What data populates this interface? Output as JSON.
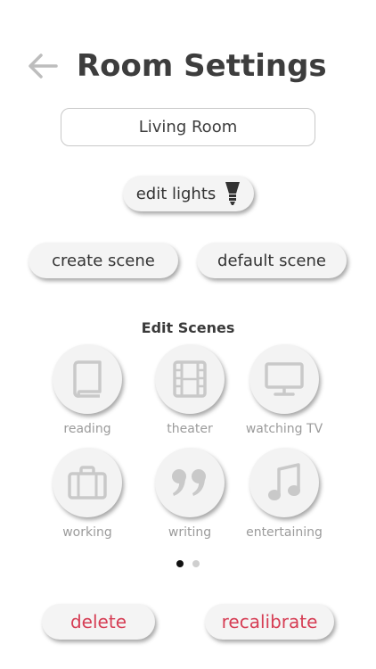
{
  "header": {
    "title": "Room Settings",
    "back_icon": "arrow-left-icon"
  },
  "room": {
    "name": "Living Room"
  },
  "actions": {
    "edit_lights_label": "edit lights",
    "edit_lights_icon": "lightbulb-icon",
    "create_scene_label": "create scene",
    "default_scene_label": "default scene"
  },
  "scenes": {
    "title": "Edit Scenes",
    "items": [
      {
        "label": "reading",
        "icon": "book-icon"
      },
      {
        "label": "theater",
        "icon": "film-icon"
      },
      {
        "label": "watching TV",
        "icon": "monitor-icon"
      },
      {
        "label": "working",
        "icon": "briefcase-icon"
      },
      {
        "label": "writing",
        "icon": "quote-icon"
      },
      {
        "label": "entertaining",
        "icon": "music-note-icon"
      }
    ]
  },
  "pagination": {
    "current": 1,
    "total": 2
  },
  "footer": {
    "delete_label": "delete",
    "recalibrate_label": "recalibrate"
  },
  "colors": {
    "danger": "#d63e55",
    "icon_gray": "#c9c9c9",
    "label_gray": "#9b9b9b"
  }
}
